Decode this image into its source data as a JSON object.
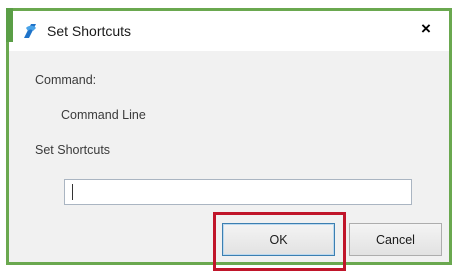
{
  "dialog": {
    "title": "Set Shortcuts",
    "close_glyph": "×"
  },
  "icons": {
    "app": "app-logo-icon",
    "close": "close-icon"
  },
  "command": {
    "label": "Command:",
    "value": "Command Line"
  },
  "shortcuts": {
    "label": "Set Shortcuts",
    "input_value": ""
  },
  "buttons": {
    "ok": "OK",
    "cancel": "Cancel"
  },
  "colors": {
    "border": "#6aa84f",
    "highlight": "#c0152a",
    "icon": "#1f73c9"
  }
}
